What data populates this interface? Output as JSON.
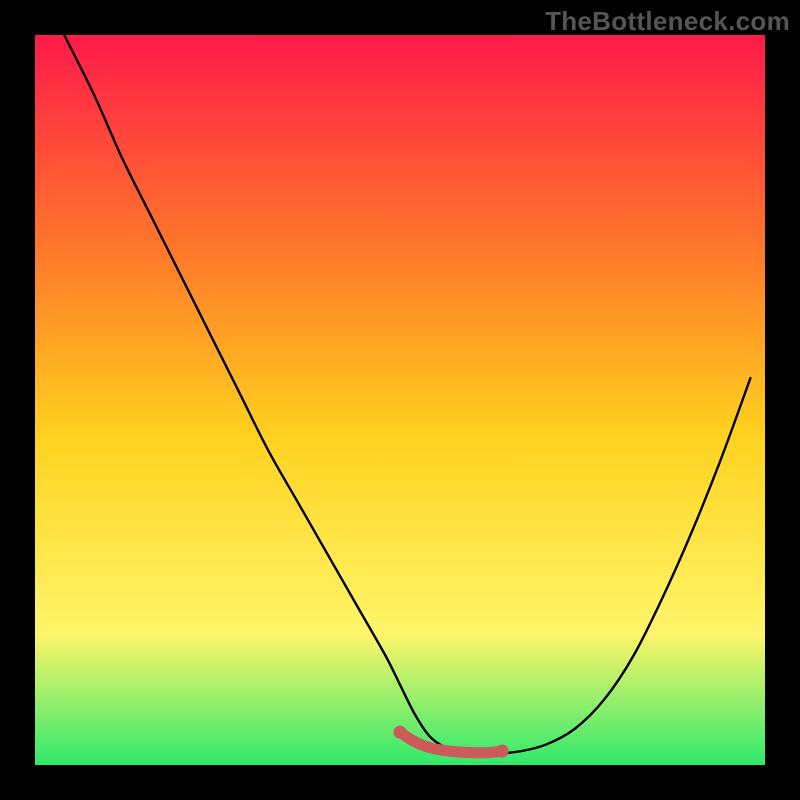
{
  "watermark": "TheBottleneck.com",
  "colors": {
    "frame": "#000000",
    "gradient_top": "#ff1a4a",
    "gradient_mid1": "#ff7a2a",
    "gradient_mid2": "#ffd21f",
    "gradient_mid3": "#fff56a",
    "gradient_bottom": "#2fe96c",
    "curve": "#000000",
    "marker_fill": "#cc5a5a",
    "marker_stroke": "#cc5a5a"
  },
  "chart_data": {
    "type": "line",
    "title": "",
    "xlabel": "",
    "ylabel": "",
    "xlim": [
      0,
      100
    ],
    "ylim": [
      0,
      100
    ],
    "series": [
      {
        "name": "bottleneck-curve",
        "x": [
          4,
          8,
          12,
          16,
          20,
          24,
          28,
          32,
          36,
          40,
          44,
          48,
          50,
          52,
          54,
          56,
          58,
          60,
          62,
          66,
          70,
          74,
          78,
          82,
          86,
          90,
          94,
          98
        ],
        "values": [
          100,
          92,
          83,
          75,
          67,
          59,
          51,
          43,
          36,
          29,
          22,
          15,
          11,
          7,
          4,
          2.5,
          1.8,
          1.5,
          1.5,
          1.8,
          2.8,
          5,
          9,
          15,
          23,
          32,
          42,
          53
        ]
      }
    ],
    "optimal_band": {
      "name": "optimal-range-marker",
      "x": [
        50,
        52,
        54,
        56,
        58,
        60,
        62,
        64
      ],
      "values": [
        4.5,
        3.2,
        2.4,
        2.0,
        1.8,
        1.7,
        1.7,
        1.9
      ]
    }
  }
}
